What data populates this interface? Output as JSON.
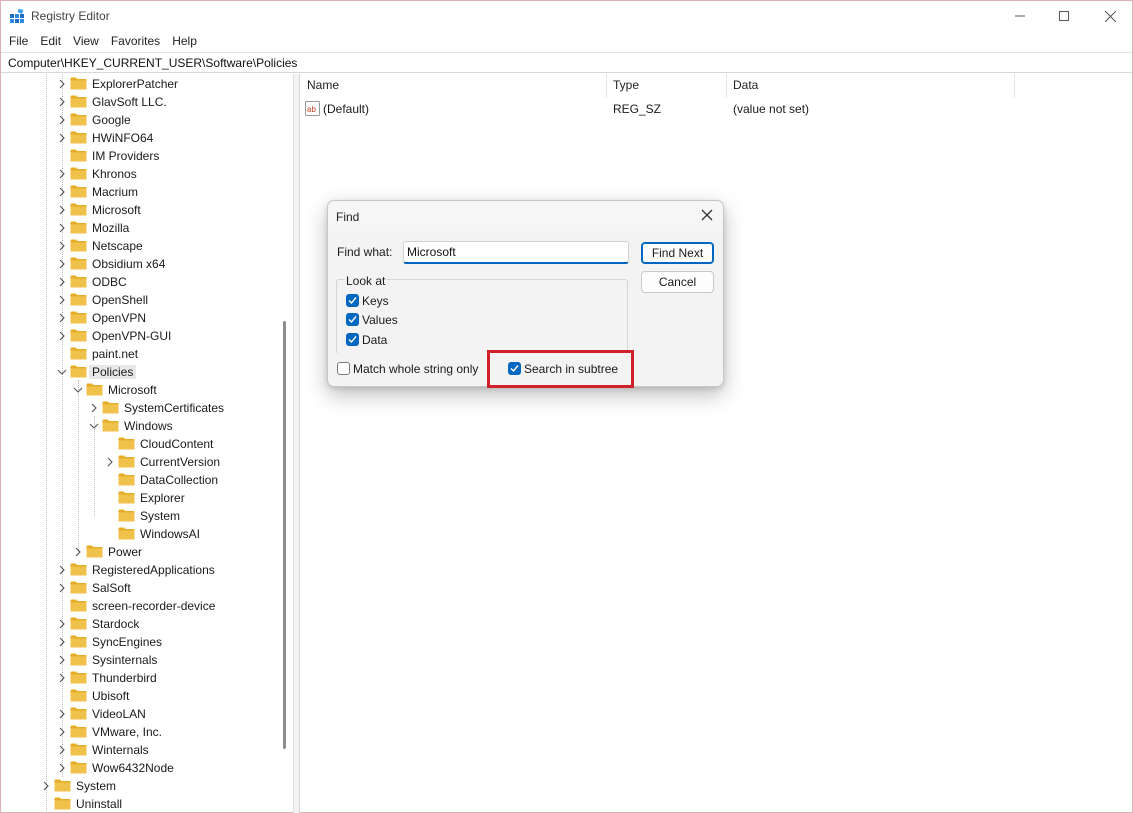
{
  "window": {
    "title": "Registry Editor"
  },
  "menu": [
    "File",
    "Edit",
    "View",
    "Favorites",
    "Help"
  ],
  "address": "Computer\\HKEY_CURRENT_USER\\Software\\Policies",
  "tree": {
    "items": [
      {
        "label": "ExplorerPatcher",
        "expandable": true
      },
      {
        "label": "GlavSoft LLC.",
        "expandable": true
      },
      {
        "label": "Google",
        "expandable": true
      },
      {
        "label": "HWiNFO64",
        "expandable": true
      },
      {
        "label": "IM Providers",
        "expandable": false
      },
      {
        "label": "Khronos",
        "expandable": true
      },
      {
        "label": "Macrium",
        "expandable": true
      },
      {
        "label": "Microsoft",
        "expandable": true
      },
      {
        "label": "Mozilla",
        "expandable": true
      },
      {
        "label": "Netscape",
        "expandable": true
      },
      {
        "label": "Obsidium x64",
        "expandable": true
      },
      {
        "label": "ODBC",
        "expandable": true
      },
      {
        "label": "OpenShell",
        "expandable": true
      },
      {
        "label": "OpenVPN",
        "expandable": true
      },
      {
        "label": "OpenVPN-GUI",
        "expandable": true
      },
      {
        "label": "paint.net",
        "expandable": false
      },
      {
        "label": "Policies",
        "expandable": true,
        "expanded": true,
        "selected": true
      },
      {
        "label": "Microsoft",
        "expandable": true,
        "expanded": true
      },
      {
        "label": "SystemCertificates",
        "expandable": true
      },
      {
        "label": "Windows",
        "expandable": true,
        "expanded": true
      },
      {
        "label": "CloudContent",
        "expandable": false
      },
      {
        "label": "CurrentVersion",
        "expandable": true
      },
      {
        "label": "DataCollection",
        "expandable": false
      },
      {
        "label": "Explorer",
        "expandable": false
      },
      {
        "label": "System",
        "expandable": false
      },
      {
        "label": "WindowsAI",
        "expandable": false
      },
      {
        "label": "Power",
        "expandable": true
      },
      {
        "label": "RegisteredApplications",
        "expandable": true
      },
      {
        "label": "SalSoft",
        "expandable": true
      },
      {
        "label": "screen-recorder-device",
        "expandable": false
      },
      {
        "label": "Stardock",
        "expandable": true
      },
      {
        "label": "SyncEngines",
        "expandable": true
      },
      {
        "label": "Sysinternals",
        "expandable": true
      },
      {
        "label": "Thunderbird",
        "expandable": true
      },
      {
        "label": "Ubisoft",
        "expandable": false
      },
      {
        "label": "VideoLAN",
        "expandable": true
      },
      {
        "label": "VMware, Inc.",
        "expandable": true
      },
      {
        "label": "Winternals",
        "expandable": true
      },
      {
        "label": "Wow6432Node",
        "expandable": true
      },
      {
        "label": "System",
        "expandable": true
      },
      {
        "label": "Uninstall",
        "expandable": false
      }
    ]
  },
  "values": {
    "columns": {
      "name": "Name",
      "type": "Type",
      "data": "Data"
    },
    "rows": [
      {
        "name": "(Default)",
        "type": "REG_SZ",
        "data": "(value not set)",
        "icon": "string-value-icon"
      }
    ]
  },
  "find_dialog": {
    "title": "Find",
    "find_what_label": "Find what:",
    "find_what_value": "Microsoft",
    "find_next_label": "Find Next",
    "cancel_label": "Cancel",
    "look_at_label": "Look at",
    "keys_label": "Keys",
    "keys_checked": true,
    "values_label": "Values",
    "values_checked": true,
    "data_label": "Data",
    "data_checked": true,
    "match_whole_label": "Match whole string only",
    "match_whole_checked": false,
    "subtree_label": "Search in subtree",
    "subtree_checked": true
  },
  "colors": {
    "accent": "#0067c0",
    "highlight": "#d0202a",
    "folder": "#f0c24b"
  }
}
